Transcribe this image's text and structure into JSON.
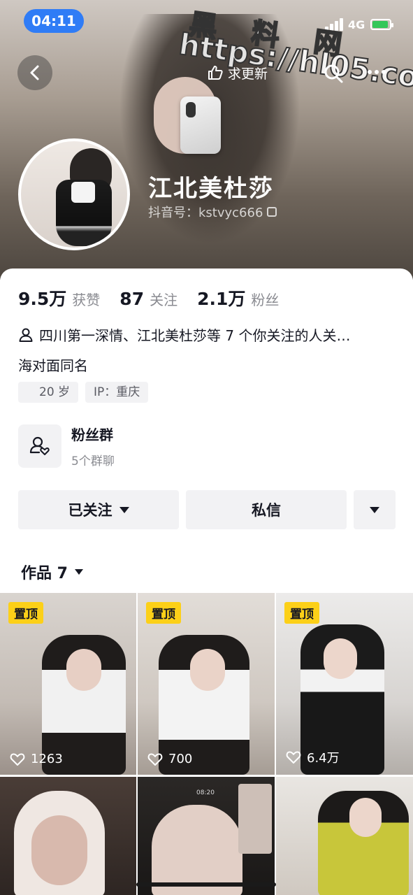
{
  "status_bar": {
    "time": "04:11",
    "network": "4G"
  },
  "watermark": {
    "chars": "黑 料 网",
    "url": "https://hl05.co"
  },
  "header": {
    "update_label": "求更新",
    "nickname": "江北美杜莎",
    "douyin_id": "抖音号：kstvyc666"
  },
  "stats": [
    {
      "value": "9.5万",
      "label": "获赞"
    },
    {
      "value": "87",
      "label": "关注"
    },
    {
      "value": "2.1万",
      "label": "粉丝"
    }
  ],
  "mutual_text": "四川第一深情、江北美杜莎等 7 个你关注的人关…",
  "bio": "海对面同名",
  "tags": {
    "age": "20 岁",
    "ip": "IP：重庆"
  },
  "fan_group": {
    "title": "粉丝群",
    "subtitle": "5个群聊"
  },
  "buttons": {
    "followed": "已关注",
    "message": "私信"
  },
  "works_tab": "作品 7",
  "videos": [
    {
      "pinned": "置顶",
      "likes": "1263"
    },
    {
      "pinned": "置顶",
      "likes": "700"
    },
    {
      "pinned": "置顶",
      "likes": "6.4万"
    },
    {
      "overlay_time": "08:20"
    },
    {},
    {}
  ],
  "colors": {
    "accent_blue": "#2f7cf6",
    "pin_yellow": "#fcd018",
    "battery_green": "#34c759"
  }
}
